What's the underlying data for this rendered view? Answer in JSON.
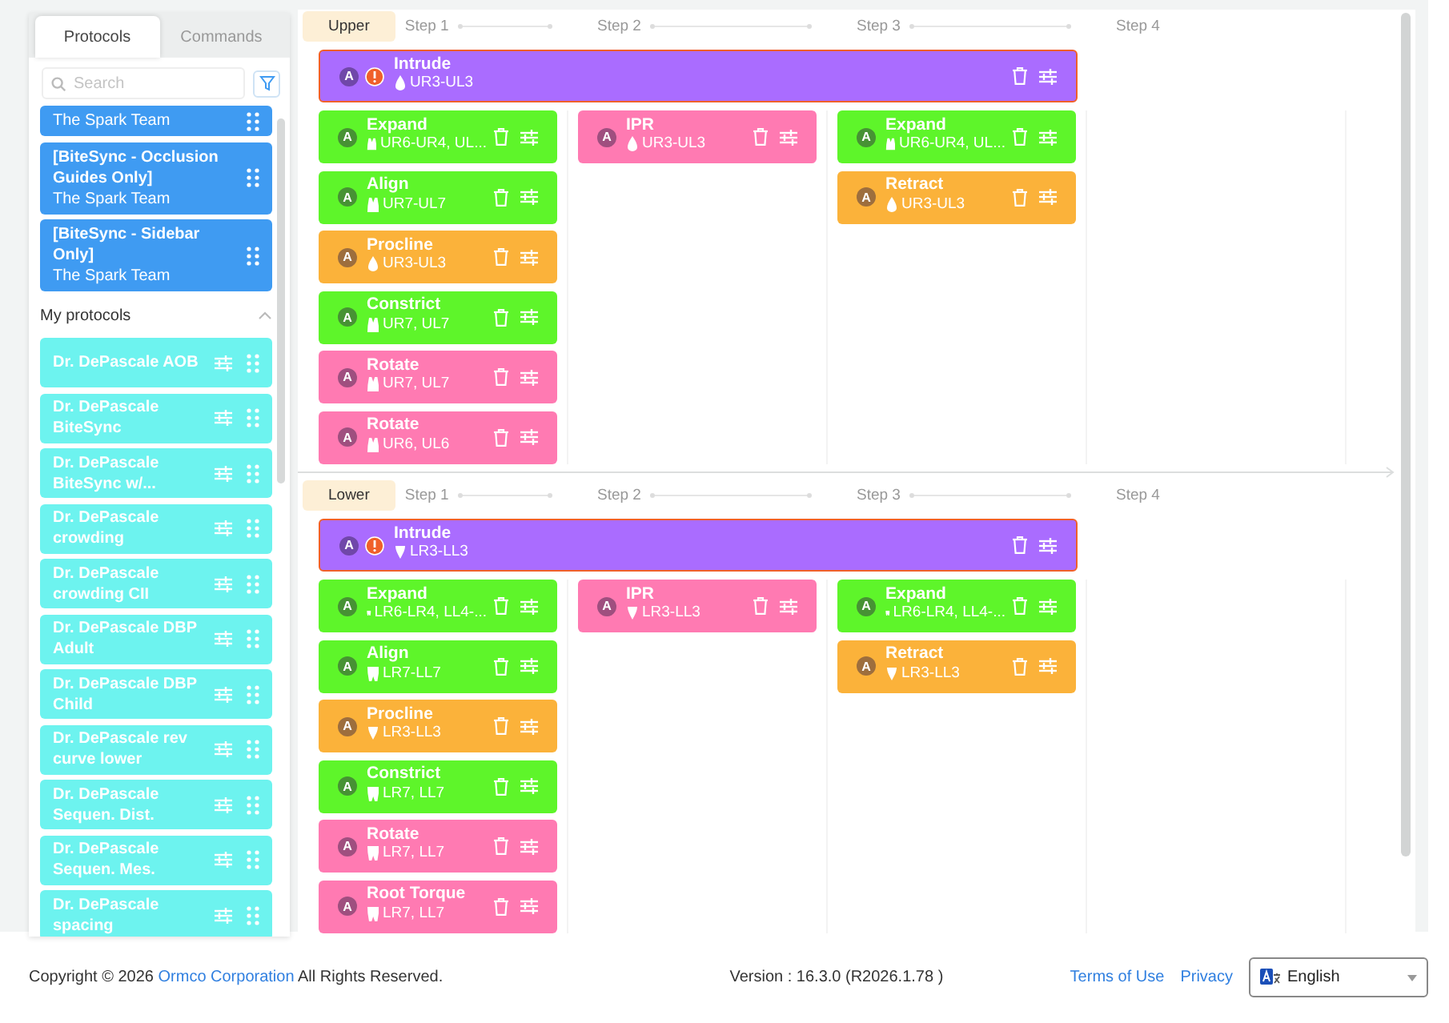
{
  "sidebar": {
    "tabs": [
      {
        "label": "Protocols",
        "selected": true
      },
      {
        "label": "Commands",
        "selected": false
      }
    ],
    "search": {
      "placeholder": "Search"
    },
    "shared_items": [
      {
        "author": "The Spark Team"
      },
      {
        "title": "[BiteSync - Occlusion Guides Only]",
        "author": "The Spark Team"
      },
      {
        "title": "[BiteSync - Sidebar Only]",
        "author": "The Spark Team"
      }
    ],
    "my_protocols": {
      "label": "My protocols",
      "expanded": true,
      "items": [
        {
          "title": "Dr. DePascale AOB"
        },
        {
          "title": "Dr. DePascale BiteSync"
        },
        {
          "title": "Dr. DePascale BiteSync w/..."
        },
        {
          "title": "Dr. DePascale crowding"
        },
        {
          "title": "Dr. DePascale crowding CII"
        },
        {
          "title": "Dr. DePascale DBP Adult"
        },
        {
          "title": "Dr. DePascale DBP Child"
        },
        {
          "title": "Dr. DePascale rev curve lower"
        },
        {
          "title": "Dr. DePascale Sequen. Dist."
        },
        {
          "title": "Dr. DePascale Sequen. Mes."
        },
        {
          "title": "Dr. DePascale spacing"
        }
      ]
    }
  },
  "sections": [
    {
      "label": "Upper",
      "steps": [
        "Step 1",
        "Step 2",
        "Step 3",
        "Step 4"
      ],
      "wide_cards": [
        {
          "badge": "A",
          "warning": true,
          "title": "Intrude",
          "teeth": "UR3-UL3",
          "kind": "canine",
          "color": "#aa6cff"
        }
      ],
      "columns": [
        [
          {
            "badge": "A",
            "warning": false,
            "title": "Expand",
            "teeth": "UR6-UR4, UL...",
            "kind": "molar",
            "color": "#5ef52a"
          },
          {
            "badge": "A",
            "warning": false,
            "title": "Align",
            "teeth": "UR7-UL7",
            "kind": "molar",
            "color": "#5ef52a"
          },
          {
            "badge": "A",
            "warning": false,
            "title": "Procline",
            "teeth": "UR3-UL3",
            "kind": "canine",
            "color": "#fbb23a"
          },
          {
            "badge": "A",
            "warning": false,
            "title": "Constrict",
            "teeth": "UR7, UL7",
            "kind": "molar",
            "color": "#5ef52a"
          },
          {
            "badge": "A",
            "warning": false,
            "title": "Rotate",
            "teeth": "UR7, UL7",
            "kind": "molar",
            "color": "#ff7ab2"
          },
          {
            "badge": "A",
            "warning": false,
            "title": "Rotate",
            "teeth": "UR6, UL6",
            "kind": "molar",
            "color": "#ff7ab2"
          }
        ],
        [
          {
            "badge": "A",
            "warning": false,
            "title": "IPR",
            "teeth": "UR3-UL3",
            "kind": "canine",
            "color": "#ff7ab2"
          }
        ],
        [
          {
            "badge": "A",
            "warning": false,
            "title": "Expand",
            "teeth": "UR6-UR4, UL...",
            "kind": "molar",
            "color": "#5ef52a"
          },
          {
            "badge": "A",
            "warning": false,
            "title": "Retract",
            "teeth": "UR3-UL3",
            "kind": "canine",
            "color": "#fbb23a"
          }
        ]
      ]
    },
    {
      "label": "Lower",
      "steps": [
        "Step 1",
        "Step 2",
        "Step 3",
        "Step 4"
      ],
      "wide_cards": [
        {
          "badge": "A",
          "warning": true,
          "title": "Intrude",
          "teeth": "LR3-LL3",
          "kind": "canine",
          "color": "#aa6cff"
        }
      ],
      "columns": [
        [
          {
            "badge": "A",
            "warning": false,
            "title": "Expand",
            "teeth": "LR6-LR4, LL4-...",
            "kind": "molar",
            "color": "#5ef52a"
          },
          {
            "badge": "A",
            "warning": false,
            "title": "Align",
            "teeth": "LR7-LL7",
            "kind": "molar",
            "color": "#5ef52a"
          },
          {
            "badge": "A",
            "warning": false,
            "title": "Procline",
            "teeth": "LR3-LL3",
            "kind": "canine",
            "color": "#fbb23a"
          },
          {
            "badge": "A",
            "warning": false,
            "title": "Constrict",
            "teeth": "LR7, LL7",
            "kind": "molar",
            "color": "#5ef52a"
          },
          {
            "badge": "A",
            "warning": false,
            "title": "Rotate",
            "teeth": "LR7, LL7",
            "kind": "molar",
            "color": "#ff7ab2"
          },
          {
            "badge": "A",
            "warning": false,
            "title": "Root Torque",
            "teeth": "LR7, LL7",
            "kind": "molar",
            "color": "#ff7ab2"
          }
        ],
        [
          {
            "badge": "A",
            "warning": false,
            "title": "IPR",
            "teeth": "LR3-LL3",
            "kind": "canine",
            "color": "#ff7ab2"
          }
        ],
        [
          {
            "badge": "A",
            "warning": false,
            "title": "Expand",
            "teeth": "LR6-LR4, LL4-...",
            "kind": "molar",
            "color": "#5ef52a"
          },
          {
            "badge": "A",
            "warning": false,
            "title": "Retract",
            "teeth": "LR3-LL3",
            "kind": "canine",
            "color": "#fbb23a"
          }
        ]
      ]
    }
  ],
  "footer": {
    "copyright_before": "Copyright © 2026",
    "company_link": "Ormco Corporation",
    "copyright_after": "All Rights Reserved.",
    "version": "Version : 16.3.0 (R2026.1.78 )",
    "links": [
      "Terms of Use",
      "Privacy"
    ],
    "language": "English"
  }
}
